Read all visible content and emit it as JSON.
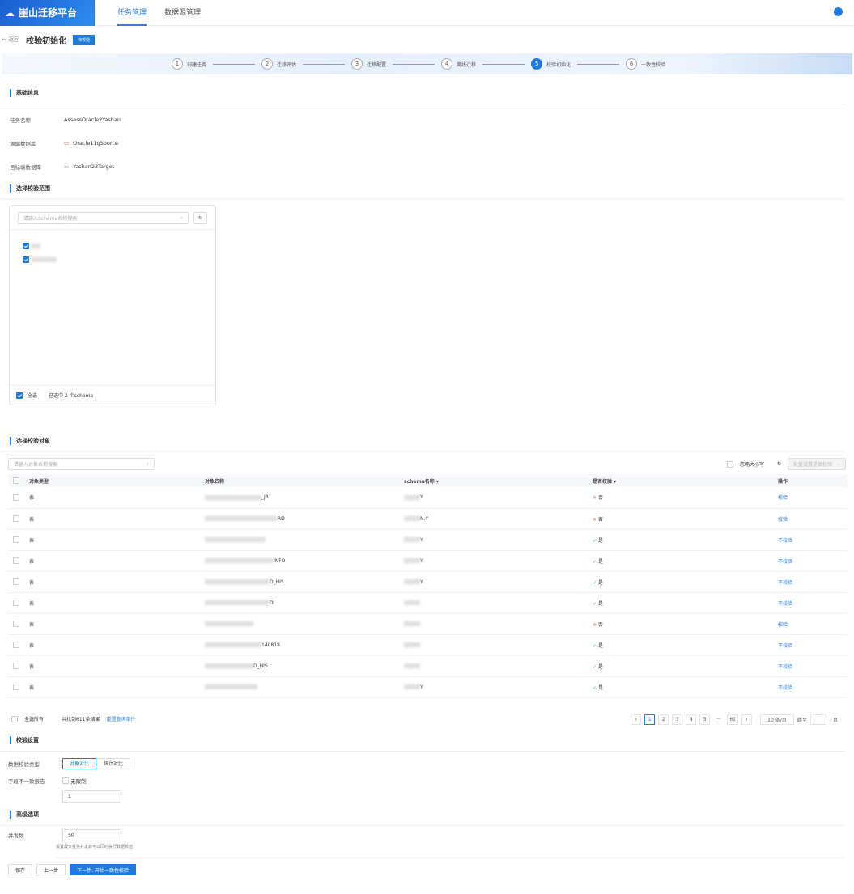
{
  "header": {
    "logo": "崖山迁移平台",
    "nav": [
      "任务管理",
      "数据源管理"
    ]
  },
  "page": {
    "back": "← 返回",
    "title": "校验初始化",
    "badge": "待校验"
  },
  "steps": [
    {
      "n": "1",
      "label": "创建任务"
    },
    {
      "n": "2",
      "label": "迁移评估"
    },
    {
      "n": "3",
      "label": "迁移配置"
    },
    {
      "n": "4",
      "label": "离线迁移"
    },
    {
      "n": "5",
      "label": "校验初始化"
    },
    {
      "n": "6",
      "label": "一致性校验"
    }
  ],
  "basic": {
    "title": "基础信息",
    "fields": [
      {
        "k": "任务名称",
        "v": "AssessOracle2Yashan"
      },
      {
        "k": "源端数据库",
        "v": "Oracle11gSource"
      },
      {
        "k": "目标端数据库",
        "v": "Yashan23Target"
      }
    ]
  },
  "scope": {
    "title": "选择校验范围",
    "placeholder": "请输入Schema名称搜索",
    "select_all": "全选",
    "selected": "已选中 2 个schema"
  },
  "objects": {
    "title": "选择校验对象",
    "placeholder": "请输入对象名称搜索",
    "ignore_case": "忽略大小写",
    "batch": "批量设置是否校验",
    "columns": [
      "对象类型",
      "对象名称",
      "schema名称",
      "是否校验",
      "操作"
    ],
    "rows": [
      {
        "type": "表",
        "name": "_JR",
        "schema": "Y",
        "check": "否",
        "ok": false,
        "op": "校验"
      },
      {
        "type": "表",
        "name": "RD",
        "schema": "N.Y",
        "check": "否",
        "ok": false,
        "op": "校验"
      },
      {
        "type": "表",
        "name": "",
        "schema": "Y",
        "check": "是",
        "ok": true,
        "op": "不校验"
      },
      {
        "type": "表",
        "name": "INFO",
        "schema": "Y",
        "check": "是",
        "ok": true,
        "op": "不校验"
      },
      {
        "type": "表",
        "name": "D_HIS",
        "schema": "Y",
        "check": "是",
        "ok": true,
        "op": "不校验"
      },
      {
        "type": "表",
        "name": "D",
        "schema": "",
        "check": "是",
        "ok": true,
        "op": "不校验"
      },
      {
        "type": "表",
        "name": "",
        "schema": "",
        "check": "否",
        "ok": false,
        "op": "校验"
      },
      {
        "type": "表",
        "name": "140818",
        "schema": "",
        "check": "是",
        "ok": true,
        "op": "不校验"
      },
      {
        "type": "表",
        "name": "D_HIS",
        "schema": "",
        "check": "是",
        "ok": true,
        "op": "不校验"
      },
      {
        "type": "表",
        "name": "",
        "schema": "Y",
        "check": "是",
        "ok": true,
        "op": "不校验"
      }
    ],
    "select_all_pages": "全选所有",
    "total": "共找到611条结果",
    "reset": "重置查询条件",
    "pages": [
      "1",
      "2",
      "3",
      "4",
      "5",
      "···",
      "61"
    ],
    "page_size": "10 条/页",
    "jump": "跳至",
    "page_unit": "页"
  },
  "settings": {
    "title": "校验设置",
    "mode_label": "数据校验类型",
    "modes": [
      "对象对比",
      "统计对比"
    ],
    "limit_label": "字段不一致报告",
    "unlimited": "无限制",
    "limit_value": "1"
  },
  "advanced": {
    "title": "高级选项",
    "parallel_label": "并发数",
    "parallel_value": "50",
    "hint": "设置最大任务并发数可以同时执行数据校验"
  },
  "footer": {
    "save": "保存",
    "prev": "上一步",
    "next": "下一步: 开始一致性校验"
  }
}
